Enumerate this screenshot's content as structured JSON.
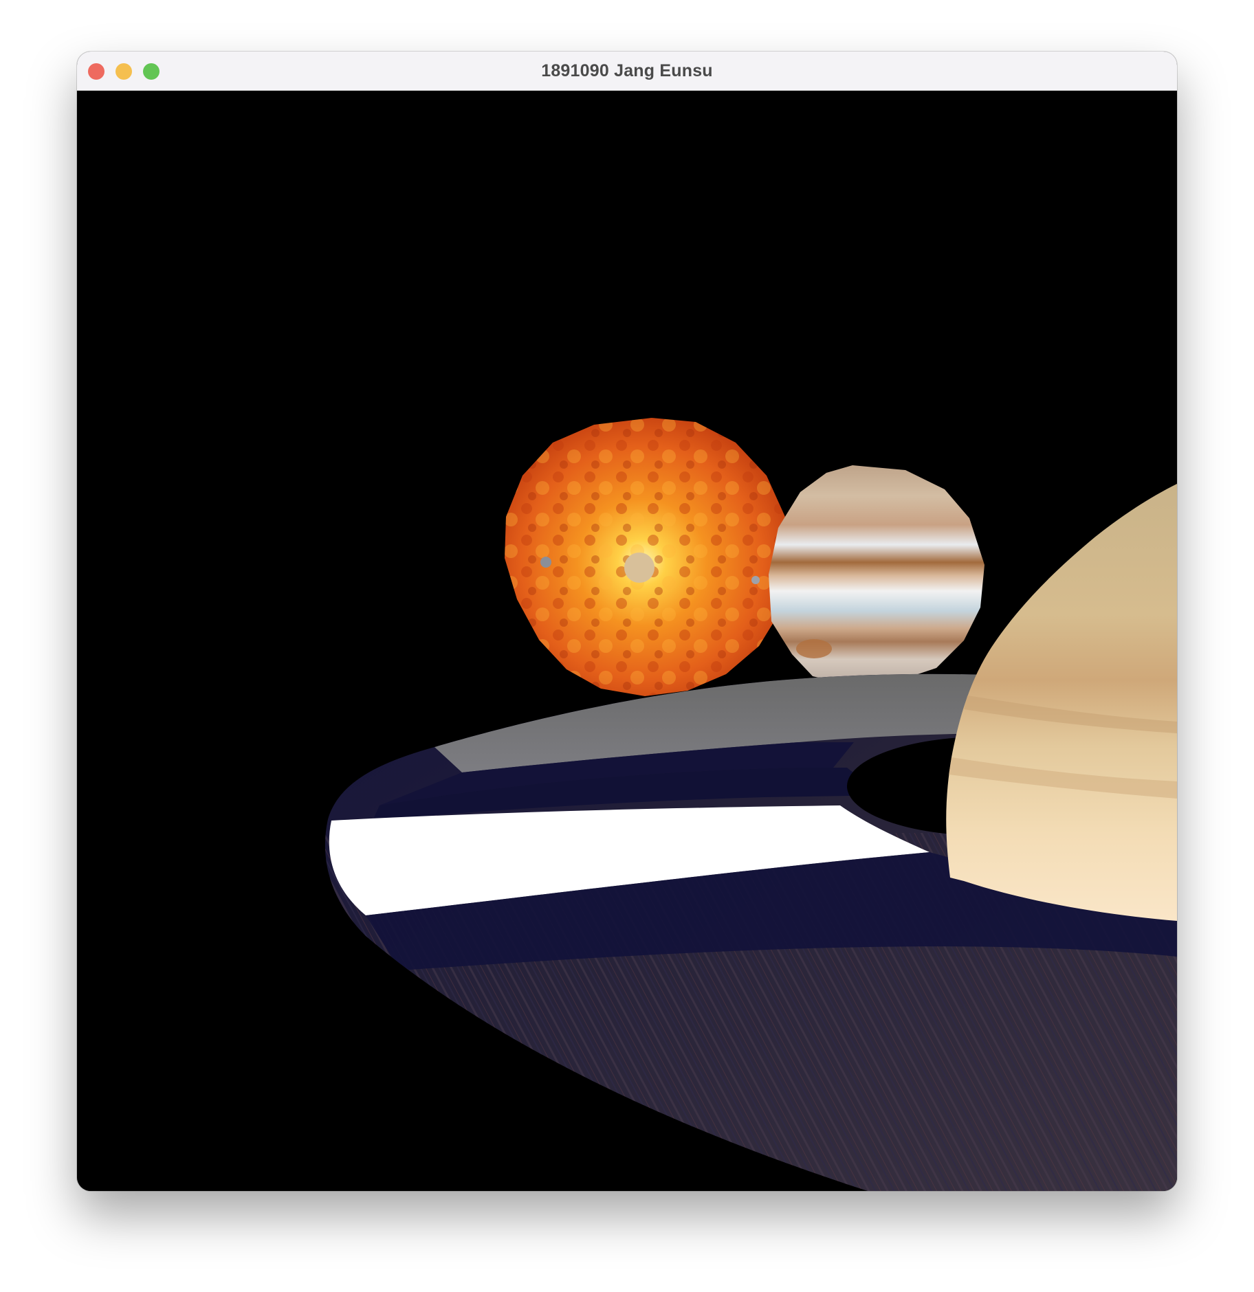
{
  "window": {
    "title": "1891090 Jang Eunsu",
    "controls": {
      "close": {
        "icon": "close-icon",
        "color": "#ee6a5f"
      },
      "minimize": {
        "icon": "minimize-icon",
        "color": "#f5bf4f"
      },
      "zoom": {
        "icon": "zoom-icon",
        "color": "#62c554"
      }
    }
  },
  "scene": {
    "background": "#000000",
    "objects": [
      {
        "name": "sun",
        "color": "#e8601c"
      },
      {
        "name": "jupiter",
        "color": "#cdb79a"
      },
      {
        "name": "saturn",
        "color": "#e6cfa3"
      },
      {
        "name": "saturn-rings",
        "color": "#1b1b3c"
      }
    ]
  }
}
